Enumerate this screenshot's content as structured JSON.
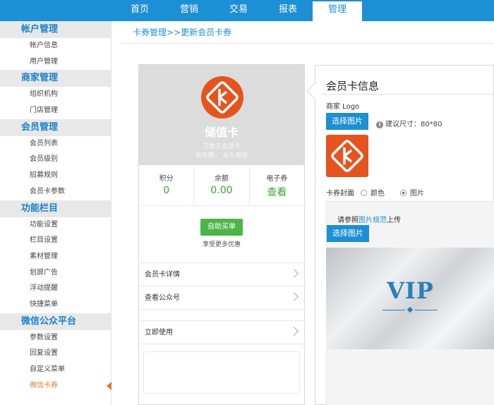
{
  "topnav": {
    "items": [
      "首页",
      "营销",
      "交易",
      "报表",
      "管理"
    ],
    "active": "管理"
  },
  "sidebar": {
    "groups": [
      {
        "title": "帐户管理",
        "items": [
          "帐户信息",
          "用户管理"
        ]
      },
      {
        "title": "商家管理",
        "items": [
          "组织机构",
          "门店管理"
        ]
      },
      {
        "title": "会员管理",
        "items": [
          "会员列表",
          "会员级别",
          "招募规则",
          "会员卡参数"
        ]
      },
      {
        "title": "功能栏目",
        "items": [
          "功能设置",
          "栏目设置",
          "素材管理",
          "划屏广告",
          "浮动提醒",
          "快捷菜单"
        ]
      },
      {
        "title": "微信公众平台",
        "items": [
          "参数设置",
          "回复设置",
          "自定义菜单",
          "微信卡券"
        ]
      }
    ],
    "active_item": "微信卡券"
  },
  "breadcrumb": "卡券管理>>更新会员卡券",
  "preview": {
    "card_name": "储值卡",
    "card_subtitle": "汉堡王会员卡",
    "validity": "有效期： 永久有效",
    "stats": [
      {
        "label": "积分",
        "value": "0"
      },
      {
        "label": "余额",
        "value": "0.00"
      },
      {
        "label": "电子券",
        "value": "查看"
      }
    ],
    "buy_button": "自助买单",
    "buy_note": "享受更多优惠",
    "menu": [
      "会员卡详情",
      "查看公众号",
      "立即使用"
    ]
  },
  "info": {
    "title": "会员卡信息",
    "logo_label": "商家 Logo",
    "select_image_button": "选择图片",
    "size_hint": "建议尺寸：80*80",
    "cover_label": "卡券封面",
    "cover_options": [
      {
        "label": "颜色",
        "checked": false
      },
      {
        "label": "图片",
        "checked": true
      }
    ],
    "cover_note_prefix": "请参照",
    "cover_note_link": "图片规范",
    "cover_note_suffix": "上传",
    "cover_select_button": "选择图片",
    "vip_text": "VIP"
  },
  "colors": {
    "brand_blue": "#1c8fd5",
    "logo_orange": "#e5541f",
    "green": "#4cb549",
    "active_orange": "#e07a2c"
  },
  "icons": {
    "card_logo": "card-ka-icon",
    "hint": "info-icon",
    "chevron": "chevron-right-icon"
  }
}
